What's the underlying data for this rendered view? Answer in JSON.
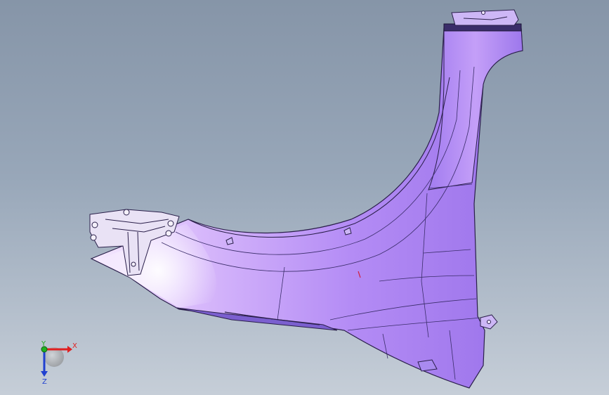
{
  "viewport": {
    "background_top": "#8695a8",
    "background_bottom": "#c6ced8"
  },
  "model": {
    "part": "fender-panel",
    "surface_color": "#b48cf5",
    "edge_color": "#2a1f4a",
    "highlight_color": "#f5e6ff"
  },
  "triad": {
    "x_label": "X",
    "y_label": "Y",
    "z_label": "Z",
    "x_color": "#e02020",
    "y_color": "#20b020",
    "z_color": "#2040d0"
  }
}
